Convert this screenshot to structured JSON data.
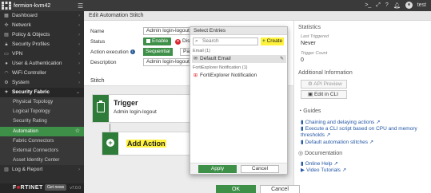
{
  "topbar": {
    "hostname": "fermion-kvm42",
    "user": "test"
  },
  "sidebar": {
    "items": [
      {
        "label": "Dashboard",
        "icon": "dashboard-icon"
      },
      {
        "label": "Network",
        "icon": "network-icon"
      },
      {
        "label": "Policy & Objects",
        "icon": "policy-icon"
      },
      {
        "label": "Security Profiles",
        "icon": "lock-icon"
      },
      {
        "label": "VPN",
        "icon": "monitor-icon"
      },
      {
        "label": "User & Authentication",
        "icon": "user-icon"
      },
      {
        "label": "WiFi Controller",
        "icon": "wifi-icon"
      },
      {
        "label": "System",
        "icon": "gear-icon"
      },
      {
        "label": "Security Fabric",
        "icon": "fabric-icon"
      }
    ],
    "subitems": [
      "Physical Topology",
      "Logical Topology",
      "Security Rating",
      "Automation",
      "Fabric Connectors",
      "External Connectors",
      "Asset Identity Center"
    ],
    "after": {
      "label": "Log & Report",
      "icon": "chart-icon"
    },
    "footer": {
      "brand": "F⬛RTINET",
      "getnews": "Get news",
      "version": "v7.0.0"
    }
  },
  "main": {
    "title": "Edit Automation Stitch",
    "form": {
      "name_label": "Name",
      "name_value": "Admin login-logout",
      "status_label": "Status",
      "status_enable": "Enable",
      "status_disable": "Disable",
      "action_label": "Action execution",
      "action_seq": "Sequential",
      "action_par": "Parallel",
      "desc_label": "Description",
      "desc_value": "Admin login-logout"
    },
    "stitch": {
      "header": "Stitch",
      "trigger_title": "Trigger",
      "trigger_sub": "Admin login-logout",
      "add_action": "Add Action"
    },
    "ok": "OK",
    "cancel": "Cancel"
  },
  "right": {
    "stats_title": "Statistics",
    "last_triggered_label": "Last Triggered",
    "last_triggered_value": "Never",
    "trigger_count_label": "Trigger Count",
    "trigger_count_value": "0",
    "addl_title": "Additional Information",
    "api_preview": "API Preview",
    "edit_cli": "Edit in CLI",
    "guides_title": "Guides",
    "guide1": "Chaining and delaying actions",
    "guide2a": "Execute a CLI script based on CPU and memory",
    "guide2b": "thresholds",
    "guide3": "Default automation stitches",
    "docs_title": "Documentation",
    "doc1": "Online Help",
    "doc2": "Video Tutorials"
  },
  "popup": {
    "title": "Select Entries",
    "search_placeholder": "Search",
    "create": "Create",
    "group1": "Email (1)",
    "item1": "Default Email",
    "group2": "FortiExplorer Notification (1)",
    "item2": "FortiExplorer Notification",
    "apply": "Apply",
    "cancel": "Cancel"
  },
  "colors": {
    "accent": "#3e8f48",
    "highlight": "#fff23d",
    "sidebar": "#2f2f2f",
    "link": "#2457a6"
  }
}
